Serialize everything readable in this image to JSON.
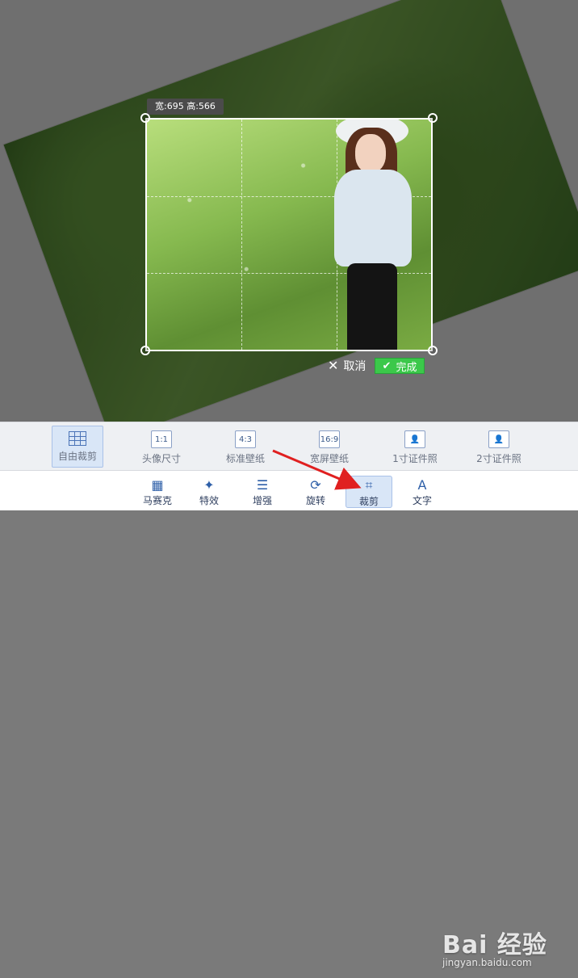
{
  "canvas": {
    "dimension_label": "宽:695  高:566",
    "cancel_label": "取消",
    "done_label": "完成"
  },
  "crop_modes": [
    {
      "label": "自由裁剪",
      "icon": "grid-icon",
      "active": true
    },
    {
      "label": "头像尺寸",
      "icon": "1:1",
      "active": false
    },
    {
      "label": "标准壁纸",
      "icon": "4:3",
      "active": false
    },
    {
      "label": "宽屏壁纸",
      "icon": "16:9",
      "active": false
    },
    {
      "label": "1寸证件照",
      "icon": "person-icon",
      "active": false
    },
    {
      "label": "2寸证件照",
      "icon": "person-icon",
      "active": false
    }
  ],
  "tools": [
    {
      "label": "马赛克",
      "icon": "mosaic-icon",
      "active": false
    },
    {
      "label": "特效",
      "icon": "magic-wand-icon",
      "active": false
    },
    {
      "label": "增强",
      "icon": "sliders-icon",
      "active": false
    },
    {
      "label": "旋转",
      "icon": "rotate-icon",
      "active": false
    },
    {
      "label": "裁剪",
      "icon": "crop-icon",
      "active": true
    },
    {
      "label": "文字",
      "icon": "text-icon",
      "active": false
    }
  ],
  "watermark": {
    "brand": "Bai 经验",
    "domain": "jingyan.baidu.com"
  },
  "colors": {
    "accent": "#2e5fa8",
    "done": "#3bc84a",
    "annotation": "#e02020"
  }
}
